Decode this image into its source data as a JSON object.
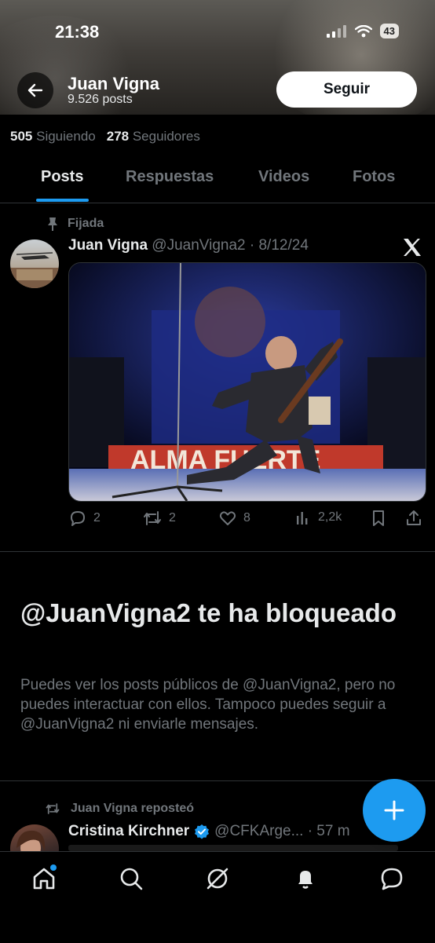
{
  "status_bar": {
    "time": "21:38",
    "battery": "43"
  },
  "header": {
    "name": "Juan Vigna",
    "posts_count": "9.526 posts",
    "follow_label": "Seguir"
  },
  "stats": {
    "following_count": "505",
    "following_label": "Siguiendo",
    "followers_count": "278",
    "followers_label": "Seguidores"
  },
  "tabs": [
    {
      "label": "Posts",
      "active": true
    },
    {
      "label": "Respuestas",
      "active": false
    },
    {
      "label": "Videos",
      "active": false
    },
    {
      "label": "Fotos",
      "active": false
    }
  ],
  "pinned_post": {
    "pinned_label": "Fijada",
    "author_name": "Juan Vigna",
    "handle_date": "@JuanVigna2 · 8/12/24",
    "media_banner_text": "ALMA FUERTE",
    "actions": {
      "replies": "2",
      "reposts": "2",
      "likes": "8",
      "views": "2,2k"
    }
  },
  "blocked": {
    "title": "@JuanVigna2 te ha bloqueado",
    "description": "Puedes ver los posts públicos de @JuanVigna2, pero no puedes interactuar con ellos. Tampoco puedes seguir a @JuanVigna2 ni enviarle mensajes."
  },
  "repost": {
    "label": "Juan Vigna reposteó",
    "author_name": "Cristina Kirchner",
    "handle_time": "@CFKArge... · 57 m",
    "verified": true
  },
  "colors": {
    "accent": "#1d9bf0",
    "background": "#000000",
    "text_secondary": "#71767b"
  },
  "icons": [
    "back-arrow-icon",
    "pin-icon",
    "x-logo-icon",
    "reply-icon",
    "repost-icon",
    "like-icon",
    "views-icon",
    "bookmark-icon",
    "share-icon",
    "verified-icon",
    "compose-plus-icon",
    "home-icon",
    "search-icon",
    "grok-icon",
    "notifications-icon",
    "messages-icon"
  ]
}
